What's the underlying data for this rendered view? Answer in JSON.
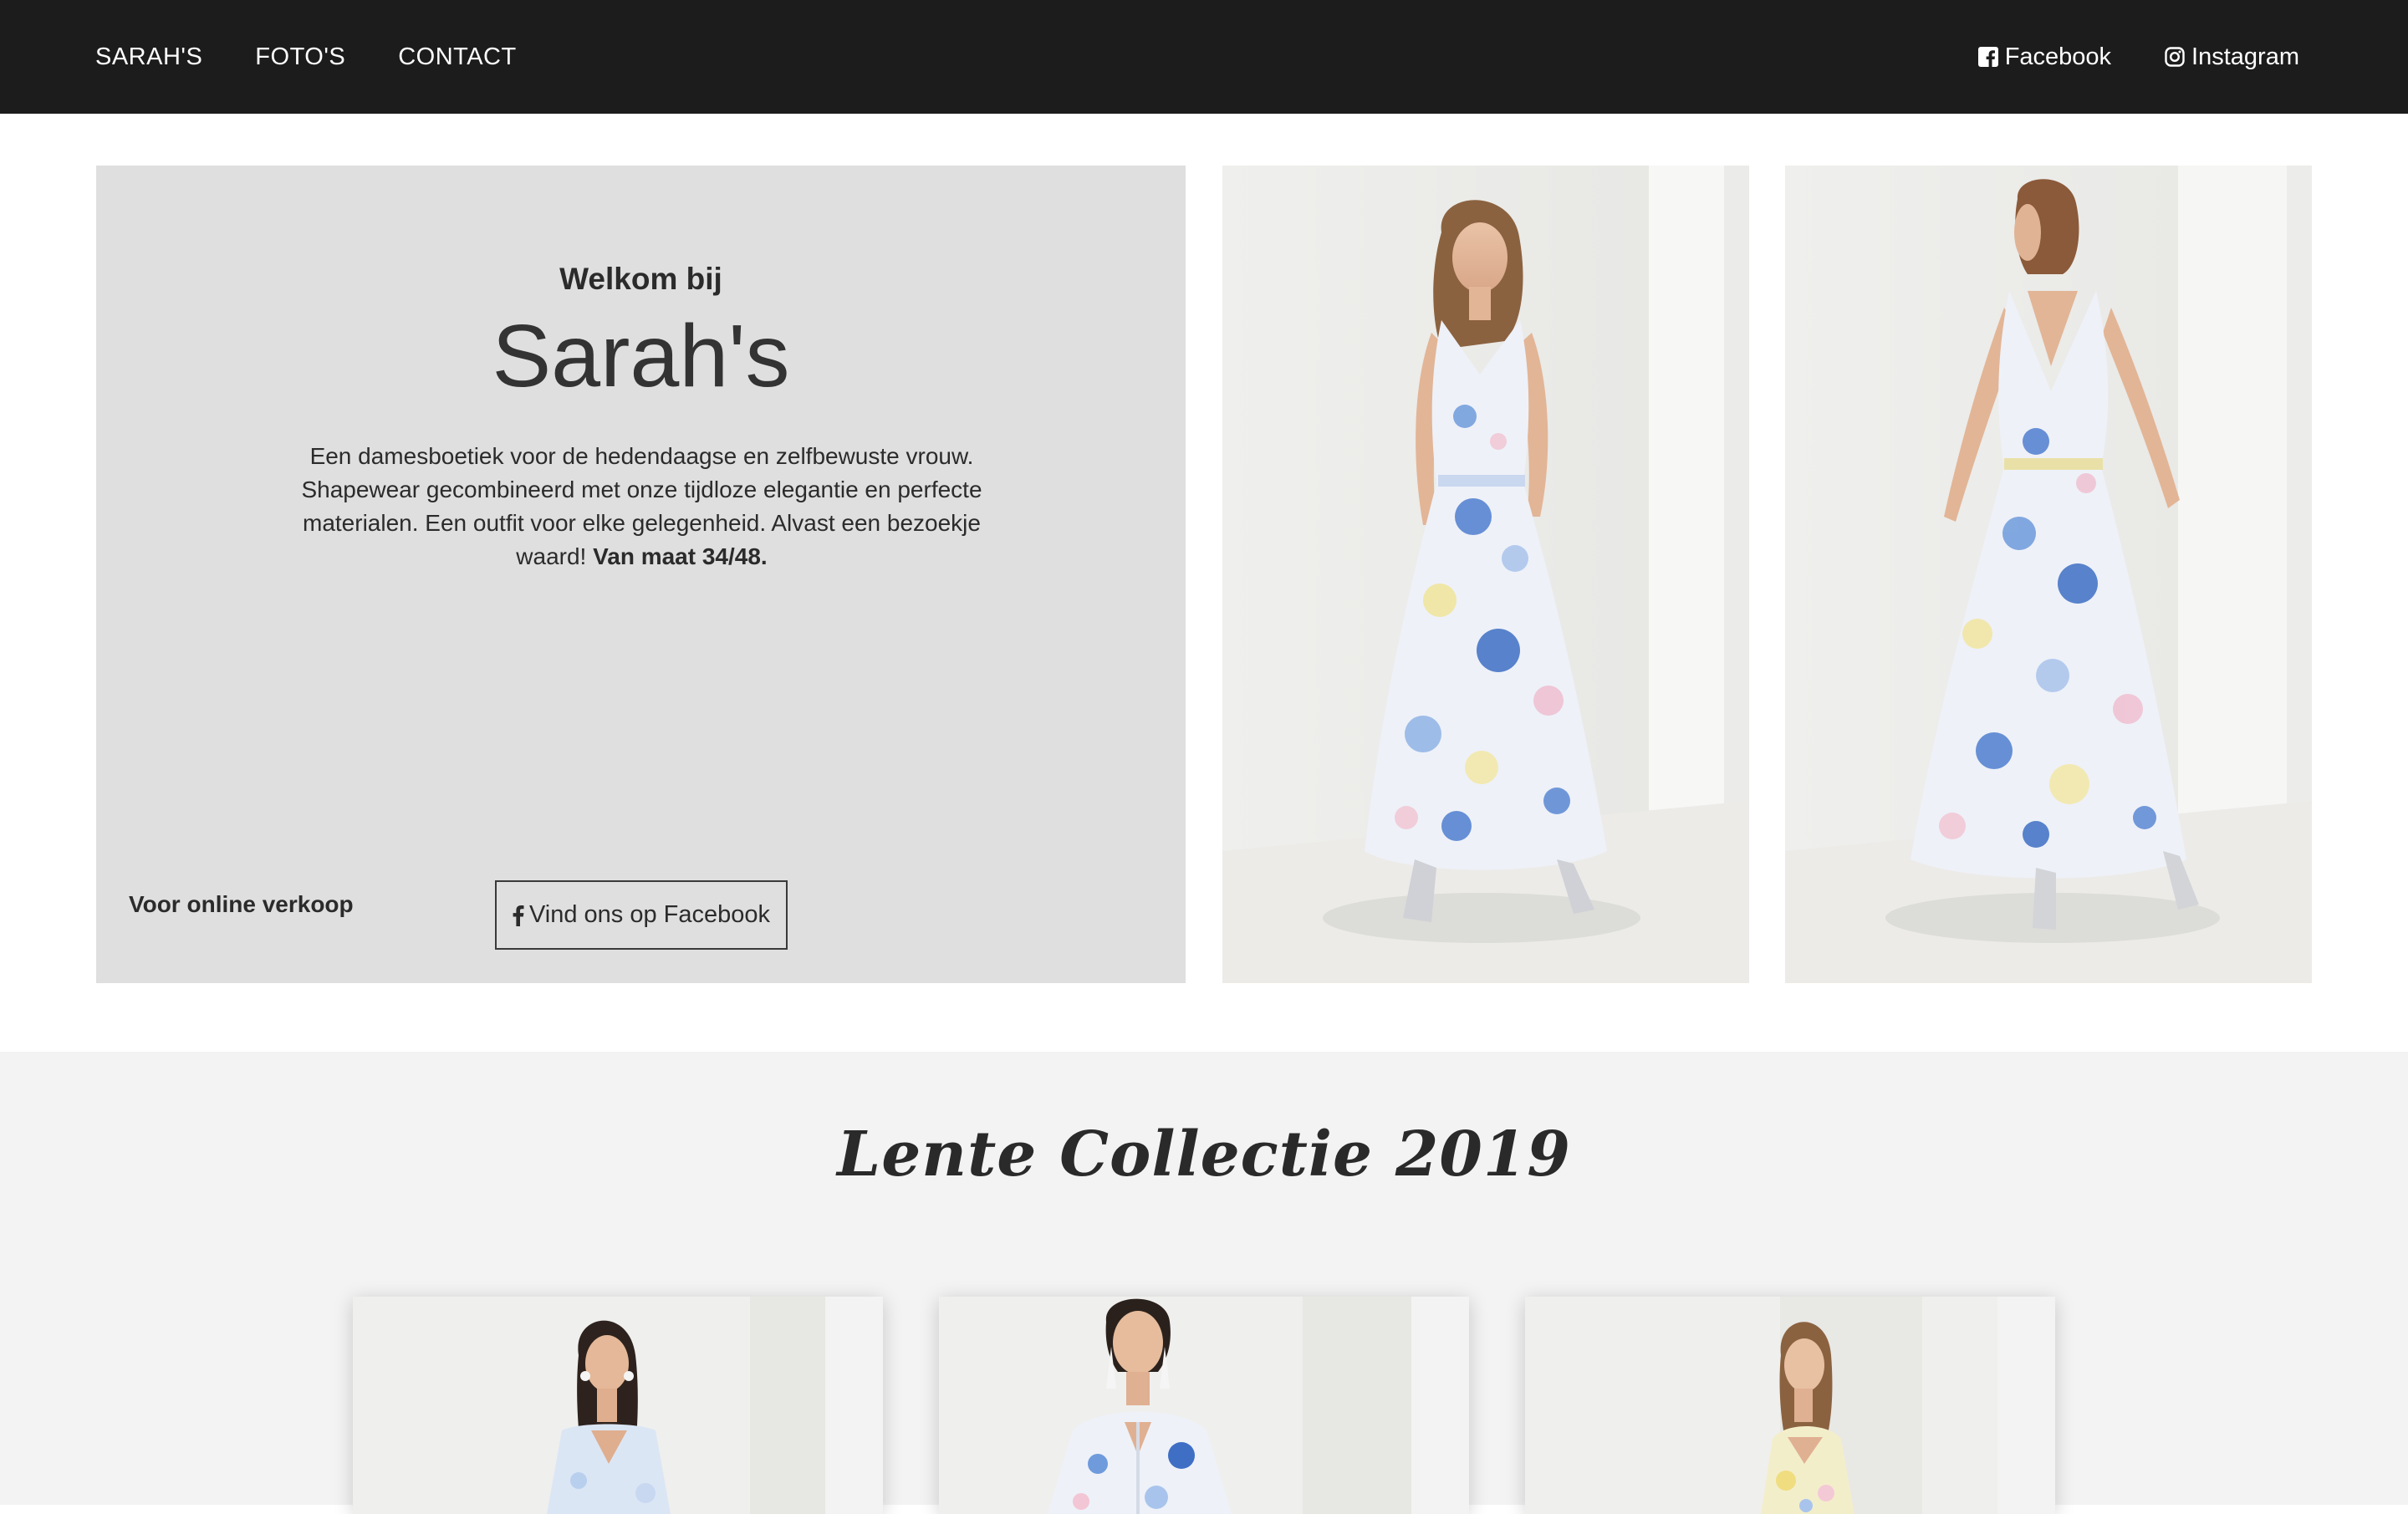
{
  "nav": {
    "links": [
      "SARAH'S",
      "FOTO'S",
      "CONTACT"
    ],
    "social": {
      "facebook_label": "Facebook",
      "instagram_label": "Instagram"
    }
  },
  "hero": {
    "welcome": "Welkom bij",
    "title": "Sarah's",
    "description": "Een damesboetiek voor de hedendaagse en zelfbewuste vrouw. Shapewear gecombineerd met onze tijdloze elegantie en perfecte materialen. Een outfit voor elke gelegenheid. Alvast een bezoekje waard!",
    "size_note": "Van maat 34/48.",
    "online_label": "Voor online verkoop",
    "facebook_button_label": "Vind ons op Facebook"
  },
  "collection": {
    "title": "Lente Collectie 2019"
  },
  "colors": {
    "navbar": "#1c1c1c",
    "hero_panel": "#dfdfdf",
    "collection_bg": "#f3f3f3",
    "dress_blue": "#4f7fcf"
  }
}
